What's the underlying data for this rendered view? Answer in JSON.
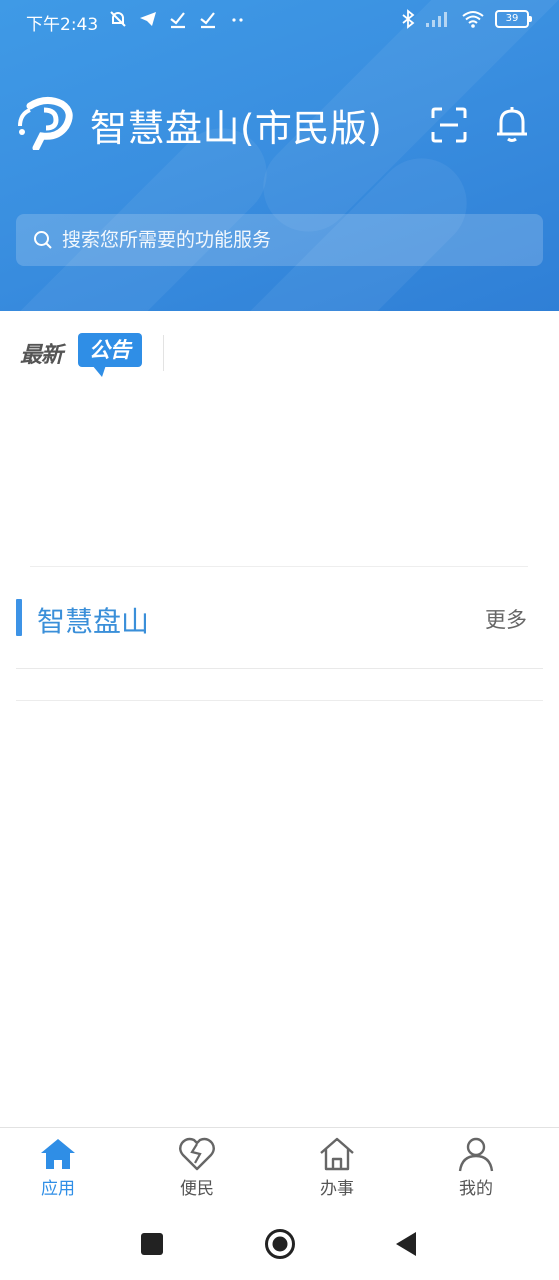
{
  "status_bar": {
    "time": "下午2:43",
    "battery": "39"
  },
  "header": {
    "title": "智慧盘山(市民版)",
    "logo_icon": "city-logo-icon",
    "scan_icon": "scan-icon",
    "notification_icon": "bell-icon"
  },
  "search": {
    "placeholder": "搜索您所需要的功能服务"
  },
  "notice": {
    "badge_part1": "最新",
    "badge_part2": "公告",
    "items": []
  },
  "section": {
    "title": "智慧盘山",
    "more": "更多"
  },
  "tabs": [
    {
      "label": "应用",
      "icon": "home-icon",
      "active": true
    },
    {
      "label": "便民",
      "icon": "heart-icon",
      "active": false
    },
    {
      "label": "办事",
      "icon": "house-outline-icon",
      "active": false
    },
    {
      "label": "我的",
      "icon": "person-icon",
      "active": false
    }
  ],
  "colors": {
    "header_blue": "#3a8fe0",
    "accent_blue": "#2f8ee6",
    "section_title": "#3a8fd9",
    "tab_inactive": "#555555"
  }
}
